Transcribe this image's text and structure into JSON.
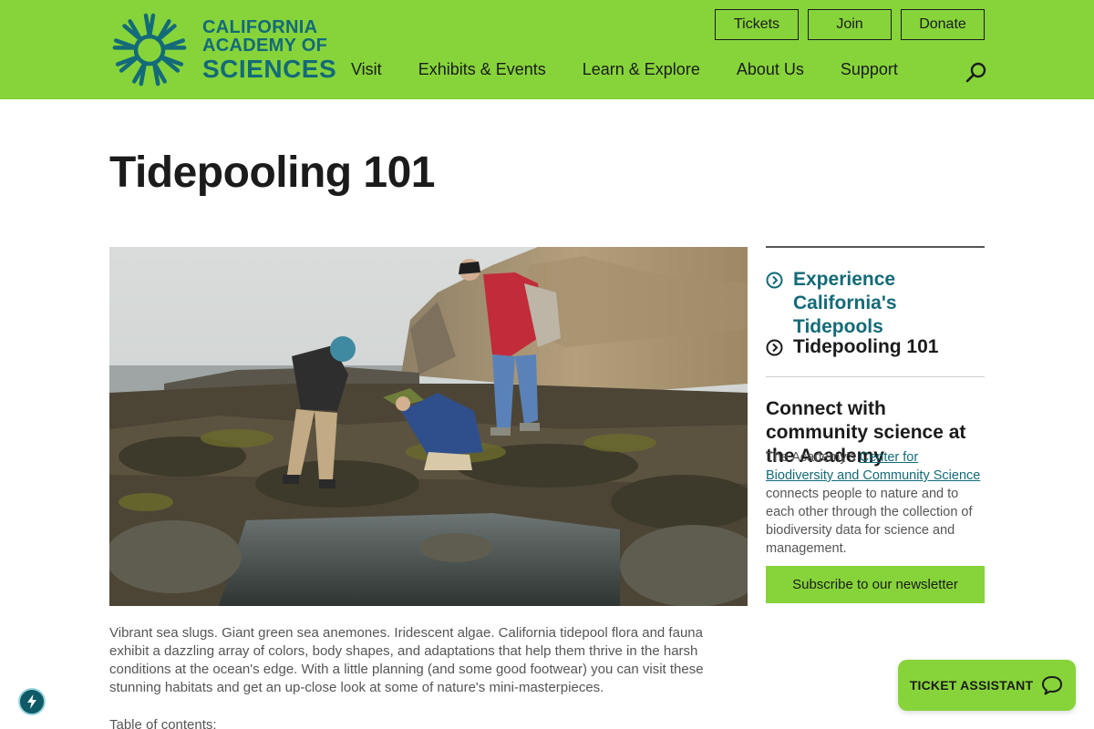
{
  "header": {
    "logo": {
      "line1": "CALIFORNIA",
      "line2": "ACADEMY OF",
      "line3": "SCIENCES",
      "icon": "starburst-logo-icon"
    },
    "utility": {
      "tickets": "Tickets",
      "join": "Join",
      "donate": "Donate"
    },
    "nav": [
      {
        "label": "Visit"
      },
      {
        "label": "Exhibits & Events"
      },
      {
        "label": "Learn & Explore"
      },
      {
        "label": "About Us"
      },
      {
        "label": "Support"
      }
    ],
    "search_icon": "search-icon"
  },
  "page": {
    "title": "Tidepooling 101"
  },
  "sidebar": {
    "links": [
      {
        "label": "Experience California's Tidepools",
        "icon": "chevron-circle-right-icon"
      },
      {
        "label": "Tidepooling 101",
        "icon": "chevron-circle-right-icon"
      }
    ],
    "promo": {
      "heading": "Connect with community science at the Academy",
      "text_before": "The Academy's ",
      "link": "Center for Biodiversity and Community Science ",
      "text_after": "connects people to nature and to each other through the collection of biodiversity data for science and management."
    },
    "subscribe_label": "Subscribe to our newsletter"
  },
  "content": {
    "intro": "Vibrant sea slugs. Giant green sea anemones. Iridescent algae. California tidepool flora and fauna exhibit a dazzling array of colors, body shapes, and adaptations that help them thrive in the harsh conditions at the ocean's edge. With a little planning (and some good footwear) you can visit these stunning habitats and get an up-close look at some of nature's mini-masterpieces.",
    "toc_label": "Table of contents:"
  },
  "floating": {
    "ticket_assistant": "TICKET ASSISTANT",
    "chat_icon": "chat-bubble-icon",
    "bolt_icon": "lightning-bolt-icon"
  },
  "colors": {
    "brand_green": "#86d43a",
    "brand_teal": "#136a78",
    "text": "#1b1b1b"
  }
}
